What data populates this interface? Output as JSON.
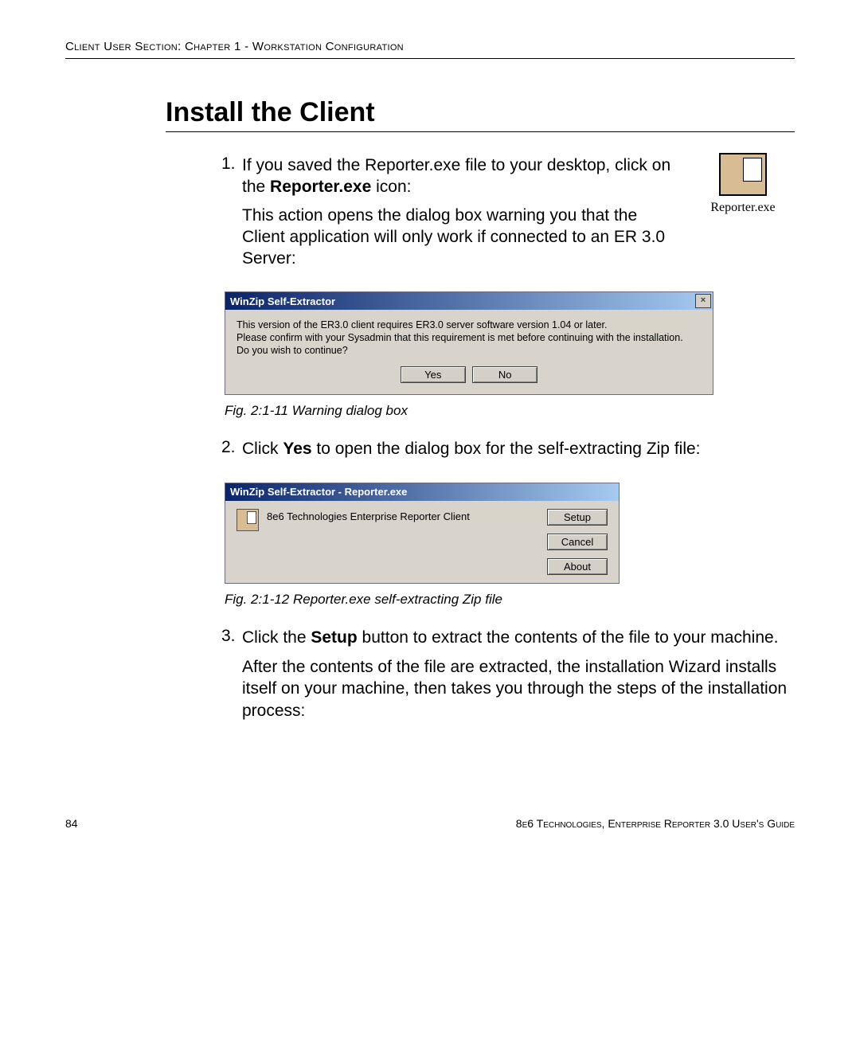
{
  "header": {
    "running_head": "Client User Section: Chapter 1 - Workstation Configuration"
  },
  "title": "Install the Client",
  "icon_caption": "Reporter.exe",
  "step1": {
    "num": "1.",
    "p1_a": "If you saved the Reporter.exe file to your desktop, click on the ",
    "p1_bold": "Reporter.exe",
    "p1_b": " icon:",
    "p2": "This action opens the dialog box warning you that the Client application will only work if connected to an ER 3.0 Server:"
  },
  "dlg1": {
    "title": "WinZip Self-Extractor",
    "close": "×",
    "line1": "This version of the ER3.0 client requires ER3.0 server software version 1.04 or later.",
    "line2": "Please confirm with your Sysadmin that this requirement is met before continuing with the installation.",
    "line3": "Do you wish to continue?",
    "yes": "Yes",
    "no": "No"
  },
  "caption1": "Fig. 2:1-11  Warning dialog box",
  "step2": {
    "num": "2.",
    "p_a": "Click ",
    "p_bold": "Yes",
    "p_b": " to open the dialog box for the self-extracting Zip file:"
  },
  "dlg2": {
    "title": "WinZip Self-Extractor - Reporter.exe",
    "desc": "8e6 Technologies Enterprise Reporter Client",
    "setup": "Setup",
    "cancel": "Cancel",
    "about": "About"
  },
  "caption2": "Fig. 2:1-12  Reporter.exe self-extracting Zip file",
  "step3": {
    "num": "3.",
    "p_a": "Click the ",
    "p_bold": "Setup",
    "p_b": " button to extract the contents of the file to your machine.",
    "p2": "After the contents of the file are extracted, the installation Wizard installs itself on your machine, then takes you through the steps of the installation process:"
  },
  "footer": {
    "page": "84",
    "guide": "8e6 Technologies, Enterprise Reporter 3.0 User's Guide"
  }
}
